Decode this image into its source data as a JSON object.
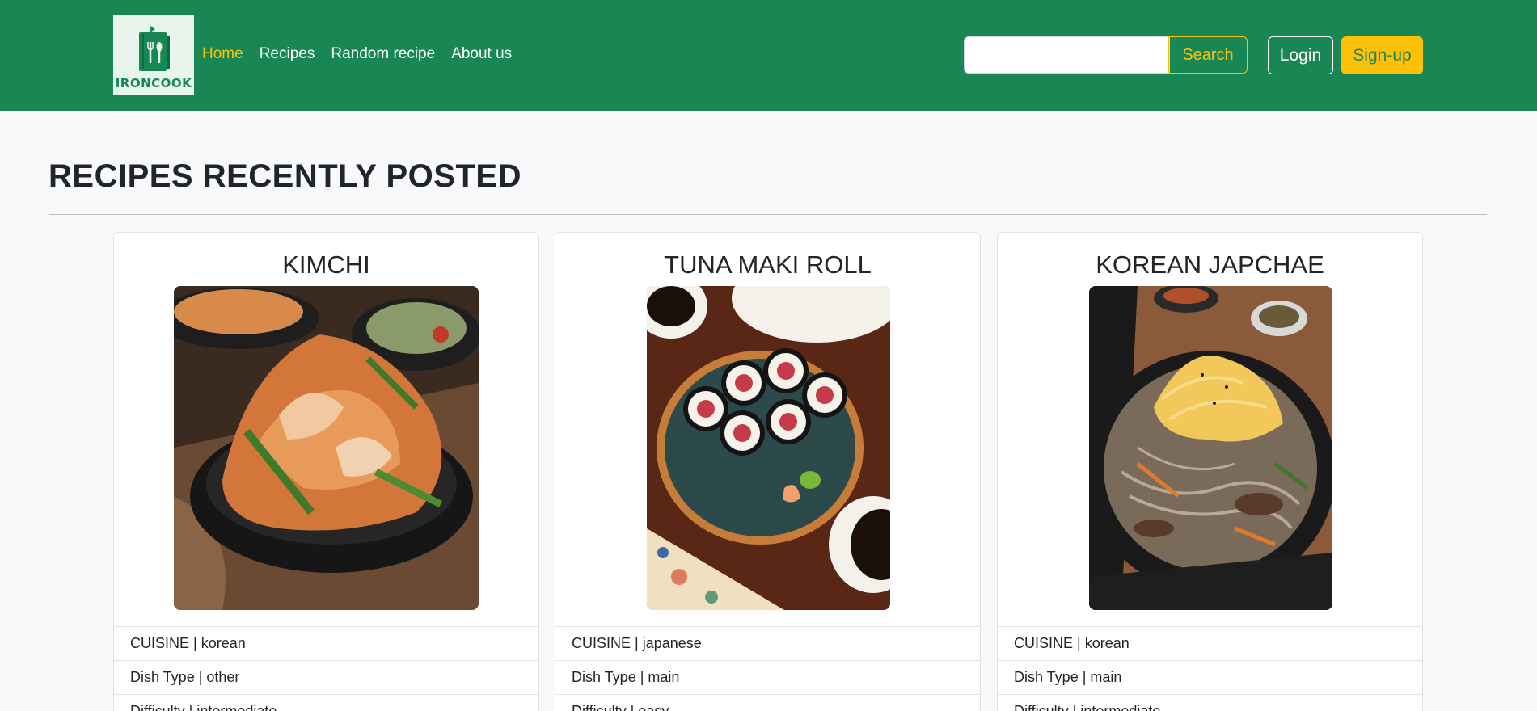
{
  "brand": {
    "logo_text": "IRONCOOK"
  },
  "nav": {
    "links": [
      {
        "label": "Home"
      },
      {
        "label": "Recipes"
      },
      {
        "label": "Random recipe"
      },
      {
        "label": "About us"
      }
    ]
  },
  "search": {
    "button_label": "Search",
    "value": ""
  },
  "auth": {
    "login_label": "Login",
    "signup_label": "Sign-up"
  },
  "main": {
    "title": "RECIPES RECENTLY POSTED",
    "recipes": [
      {
        "title": "KIMCHI",
        "cuisine": "CUISINE | korean",
        "dish_type": "Dish Type | other",
        "difficulty": "Difficulty | intermediate"
      },
      {
        "title": "TUNA MAKI ROLL",
        "cuisine": "CUISINE | japanese",
        "dish_type": "Dish Type | main",
        "difficulty": "Difficulty | easy"
      },
      {
        "title": "KOREAN JAPCHAE",
        "cuisine": "CUISINE | korean",
        "dish_type": "Dish Type | main",
        "difficulty": "Difficulty | intermediate"
      }
    ]
  },
  "colors": {
    "primary": "#198754",
    "accent": "#ffc107",
    "background": "#f8f9fa"
  }
}
